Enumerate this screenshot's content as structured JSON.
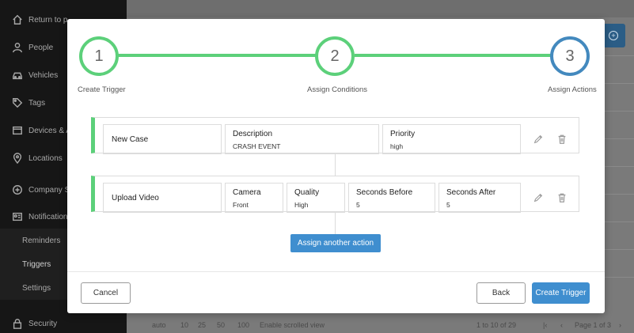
{
  "sidebar": {
    "items": [
      {
        "label": "Return to p",
        "icon": "home-icon"
      },
      {
        "label": "People",
        "icon": "user-icon"
      },
      {
        "label": "Vehicles",
        "icon": "car-icon"
      },
      {
        "label": "Tags",
        "icon": "tag-icon"
      },
      {
        "label": "Devices & A",
        "icon": "device-icon"
      },
      {
        "label": "Locations",
        "icon": "location-pin-icon"
      },
      {
        "label": "Company S",
        "icon": "company-settings-icon"
      },
      {
        "label": "Notification",
        "icon": "notification-card-icon"
      },
      {
        "label": "Reminders",
        "icon": ""
      },
      {
        "label": "Triggers",
        "icon": ""
      },
      {
        "label": "Settings",
        "icon": ""
      },
      {
        "label": "Security",
        "icon": "lock-icon"
      }
    ]
  },
  "background_footer": {
    "page_size_options": [
      "auto",
      "10",
      "25",
      "50",
      "100"
    ],
    "scroll_toggle": "Enable scrolled view",
    "range_text": "1 to 10 of 29",
    "page_text": "Page 1 of 3"
  },
  "stepper": {
    "steps": [
      {
        "number": "1",
        "label": "Create Trigger",
        "state": "complete"
      },
      {
        "number": "2",
        "label": "Assign Conditions",
        "state": "complete"
      },
      {
        "number": "3",
        "label": "Assign Actions",
        "state": "active"
      }
    ]
  },
  "actions": [
    {
      "title": "New Case",
      "fields": [
        {
          "label": "Description",
          "value": "CRASH EVENT"
        },
        {
          "label": "Priority",
          "value": "high"
        }
      ]
    },
    {
      "title": "Upload Video",
      "fields": [
        {
          "label": "Camera",
          "value": "Front"
        },
        {
          "label": "Quality",
          "value": "High"
        },
        {
          "label": "Seconds Before",
          "value": "5"
        },
        {
          "label": "Seconds After",
          "value": "5"
        }
      ]
    }
  ],
  "buttons": {
    "assign_another": "Assign another action",
    "cancel": "Cancel",
    "back": "Back",
    "create_trigger": "Create Trigger"
  },
  "colors": {
    "complete": "#5cd07a",
    "active": "#4389be",
    "primary_button": "#3f8ecf"
  }
}
